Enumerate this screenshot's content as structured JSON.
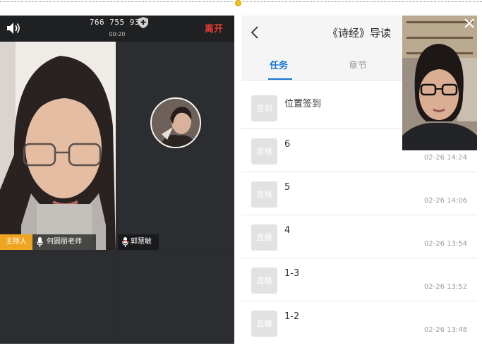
{
  "meeting": {
    "id": "766 755 934",
    "elapsed": "00:20",
    "leave_label": "离开"
  },
  "participants": [
    {
      "badge": "主持人",
      "name": "何圆丽老师"
    },
    {
      "name": "郭慧敏"
    }
  ],
  "course": {
    "title": "《诗经》导读",
    "tabs": [
      {
        "label": "任务",
        "active": true
      },
      {
        "label": "章节",
        "active": false
      }
    ],
    "tasks": [
      {
        "chip": "签到",
        "title": "位置签到",
        "time": ""
      },
      {
        "chip": "直播",
        "title": "6",
        "time": "02-26 14:24"
      },
      {
        "chip": "直播",
        "title": "5",
        "time": "02-26 14:06"
      },
      {
        "chip": "直播",
        "title": "4",
        "time": "02-26 13:54"
      },
      {
        "chip": "直播",
        "title": "1-3",
        "time": "02-26 13:52"
      },
      {
        "chip": "直播",
        "title": "1-2",
        "time": "02-26 13:48"
      }
    ]
  },
  "colors": {
    "accent": "#1677d6",
    "leave": "#e23b33",
    "host_badge": "#f0a521"
  },
  "icons": [
    "speaker-icon",
    "shield-icon",
    "microphone-icon",
    "back-chevron-icon",
    "close-icon"
  ]
}
